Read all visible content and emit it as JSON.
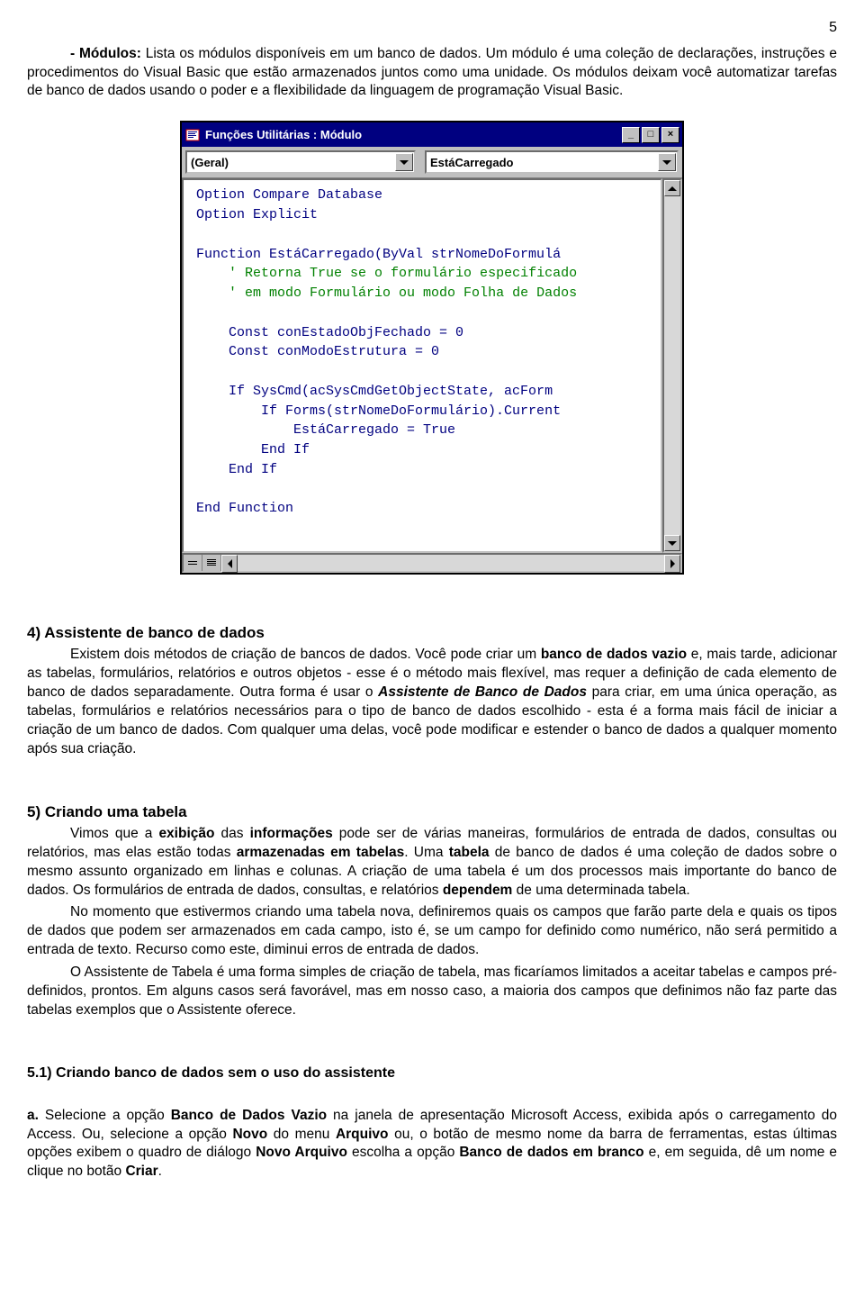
{
  "page_number": "5",
  "intro": {
    "label": "- Módulos:",
    "text1": " Lista os módulos disponíveis em um banco de dados. Um módulo é uma coleção de declarações, instruções e procedimentos do Visual Basic que estão armazenados juntos como uma unidade. Os módulos deixam você automatizar tarefas de banco de dados usando o poder e a flexibilidade da linguagem de programação Visual Basic."
  },
  "window": {
    "title": "Funções Utilitárias : Módulo",
    "dropdown_left": "(Geral)",
    "dropdown_right": "EstáCarregado",
    "code_lines": [
      "Option Compare Database",
      "Option Explicit",
      "",
      "Function EstáCarregado(ByVal strNomeDoFormulá",
      "    ' Retorna True se o formulário especificado",
      "    ' em modo Formulário ou modo Folha de Dados",
      "",
      "    Const conEstadoObjFechado = 0",
      "    Const conModoEstrutura = 0",
      "",
      "    If SysCmd(acSysCmdGetObjectState, acForm",
      "        If Forms(strNomeDoFormulário).Current",
      "            EstáCarregado = True",
      "        End If",
      "    End If",
      "",
      "End Function"
    ]
  },
  "sec4": {
    "title": "4) Assistente de banco de dados",
    "p1a": "Existem dois métodos de criação de bancos de dados. Você pode criar um ",
    "p1b": "banco de dados vazio",
    "p1c": " e, mais tarde, adicionar as tabelas, formulários, relatórios e outros objetos - esse é o método mais flexível, mas requer a definição de cada elemento de banco de dados separadamente. Outra forma é usar o ",
    "p1d": "Assistente de Banco de Dados",
    "p1e": " para criar, em uma única operação, as tabelas, formulários e relatórios necessários para o tipo de banco de dados escolhido - esta é a forma mais fácil de iniciar a criação de um banco de dados. Com qualquer uma delas, você pode modificar e estender o banco de dados a qualquer momento após sua criação."
  },
  "sec5": {
    "title": "5) Criando uma tabela",
    "p1a": "Vimos que a ",
    "p1b": "exibição",
    "p1c": " das ",
    "p1d": "informações",
    "p1e": " pode ser de várias maneiras, formulários de entrada de dados, consultas ou relatórios, mas elas estão todas ",
    "p1f": "armazenadas em tabelas",
    "p1g": ". Uma ",
    "p1h": "tabela",
    "p1i": " de banco de dados é uma coleção de dados sobre o mesmo assunto organizado em linhas e colunas. A criação de uma tabela é um dos processos mais importante do banco de dados. Os formulários de entrada de dados, consultas, e relatórios ",
    "p1j": "dependem",
    "p1k": " de uma determinada tabela.",
    "p2": "No momento que estivermos criando uma tabela nova, definiremos quais os campos que farão parte dela e quais os tipos de dados que podem ser armazenados em cada campo, isto é, se um campo for definido como numérico, não será permitido a entrada de texto. Recurso como este, diminui erros de entrada de dados.",
    "p3": "O Assistente de Tabela é uma forma simples de criação de tabela, mas ficaríamos limitados a aceitar tabelas e campos pré-definidos, prontos. Em alguns casos será favorável, mas em nosso caso, a maioria dos campos que definimos não faz parte das tabelas exemplos que o Assistente oferece."
  },
  "sec51": {
    "title": "5.1) Criando banco de dados sem o uso do assistente",
    "a_label": "a.",
    "a1": " Selecione a opção ",
    "a2": "Banco de Dados Vazio",
    "a3": " na janela de apresentação Microsoft Access, exibida após o carregamento do Access. Ou, selecione a opção ",
    "a4": "Novo",
    "a5": " do menu ",
    "a6": "Arquivo",
    "a7": " ou, o botão de mesmo nome da barra de ferramentas, estas últimas opções exibem o quadro de diálogo ",
    "a8": "Novo Arquivo",
    "a9": " escolha a opção ",
    "a10": "Banco de dados em branco",
    "a11": " e, em seguida, dê um nome e clique no botão ",
    "a12": "Criar",
    "a13": "."
  }
}
